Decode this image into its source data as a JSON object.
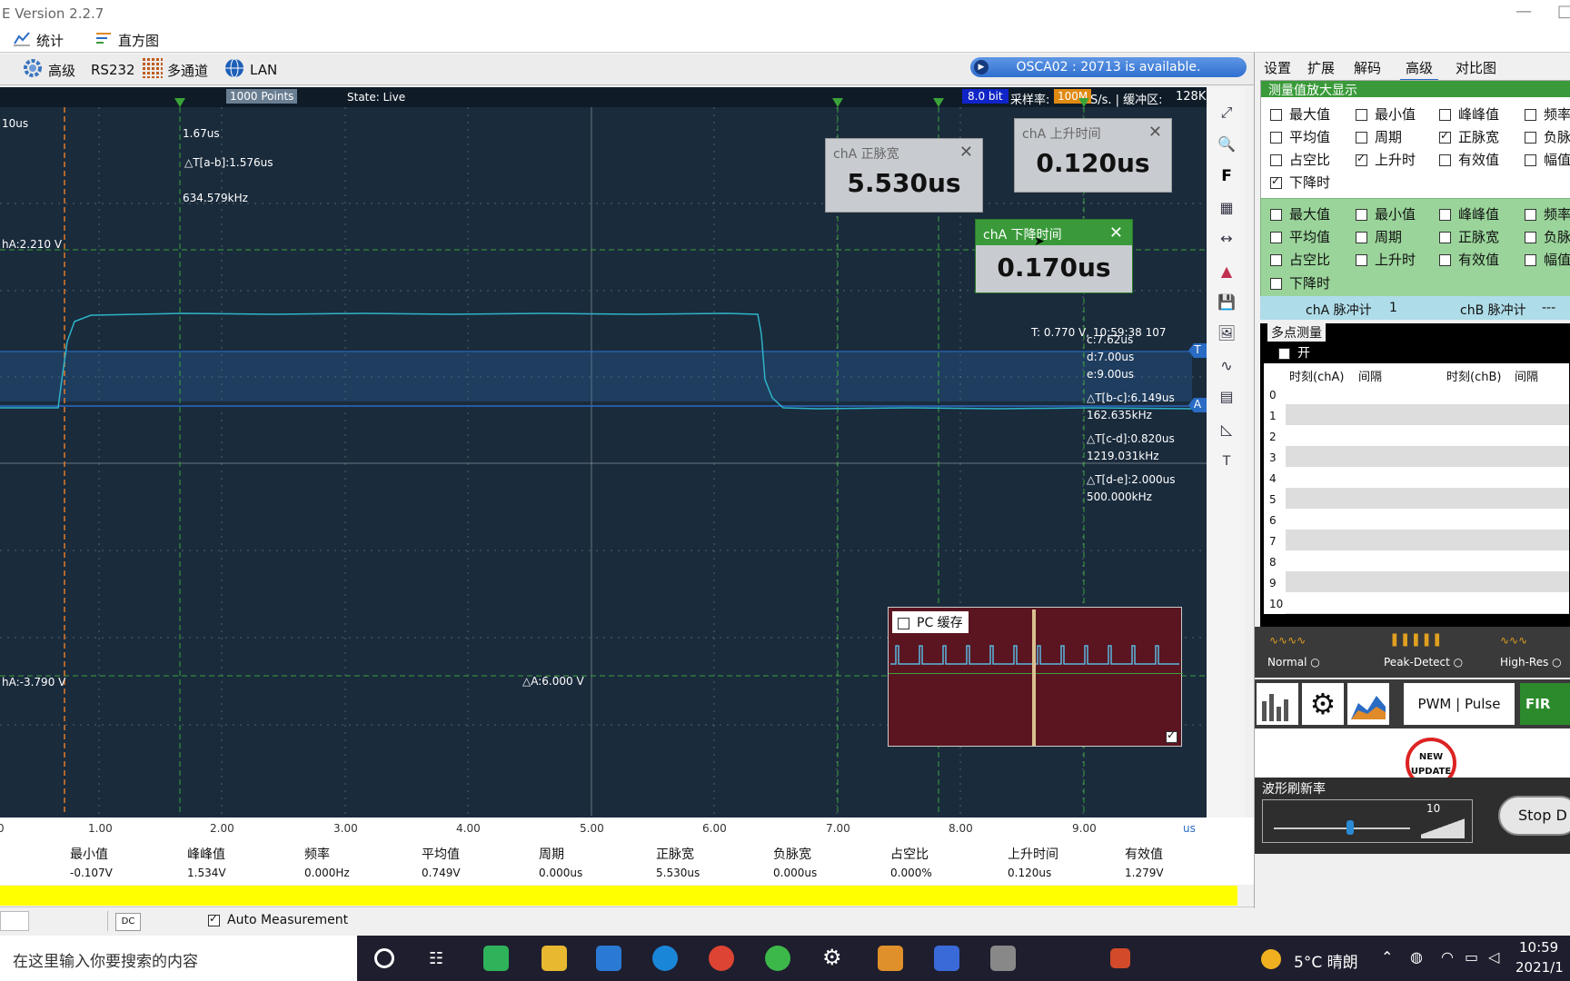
{
  "window": {
    "title": "E Version 2.2.7"
  },
  "menu": [
    {
      "label": "统计"
    },
    {
      "label": "直方图"
    }
  ],
  "toolbar": {
    "advanced": "高级",
    "rs232": "RS232",
    "multichannel": "多通道",
    "lan": "LAN",
    "device_status": "OSCA02 : 20713 is available."
  },
  "scope_status": {
    "points": "1000 Points",
    "state": "State: Live",
    "bits": "8.0 bit",
    "sample_rate_label": "采样率:",
    "sample_rate": "100M",
    "sample_rate_unit": "S/s. | 缓冲区:",
    "buffer": "128K."
  },
  "cursor_info": {
    "time_left": "10us",
    "cursor_b": "1.67us",
    "delta_ab": "△T[a-b]:1.576us",
    "freq_ab": "634.579kHz",
    "cha_top": "hA:2.210 V",
    "cha_bottom": "hA:-3.790 V",
    "delta_a": "△A:6.000 V",
    "trigger": "T: 0.770 V, 10:59:38 107",
    "c": "c:7.62us",
    "d": "d:7.00us",
    "e": "e:9.00us",
    "delta_bc": "△T[b-c]:6.149us",
    "freq_bc": "162.635kHz",
    "delta_cd": "△T[c-d]:0.820us",
    "freq_cd": "1219.031kHz",
    "delta_de": "△T[d-e]:2.000us",
    "freq_de": "500.000kHz",
    "marker_t": "T",
    "marker_a": "A"
  },
  "measurement_boxes": [
    {
      "title": "chA 正脉宽",
      "value": "5.530us"
    },
    {
      "title": "chA 上升时间",
      "value": "0.120us"
    },
    {
      "title": "chA 下降时间",
      "value": "0.170us"
    }
  ],
  "pc_cache": {
    "label": "PC 缓存",
    "checked": false,
    "thumb_checked": true
  },
  "right_toolbar": {
    "f_label": "F",
    "t_label": "T"
  },
  "x_axis": {
    "ticks": [
      "0",
      "1.00",
      "2.00",
      "3.00",
      "4.00",
      "5.00",
      "6.00",
      "7.00",
      "8.00",
      "9.00"
    ],
    "unit": "us"
  },
  "stats": [
    {
      "label": "最小值",
      "value": "-0.107V"
    },
    {
      "label": "峰峰值",
      "value": "1.534V"
    },
    {
      "label": "频率",
      "value": "0.000Hz"
    },
    {
      "label": "平均值",
      "value": "0.749V"
    },
    {
      "label": "周期",
      "value": "0.000us"
    },
    {
      "label": "正脉宽",
      "value": "5.530us"
    },
    {
      "label": "负脉宽",
      "value": "0.000us"
    },
    {
      "label": "占空比",
      "value": "0.000%"
    },
    {
      "label": "上升时间",
      "value": "0.120us"
    },
    {
      "label": "有效值",
      "value": "1.279V"
    }
  ],
  "bottom": {
    "dc": "DC",
    "auto_measurement": "Auto Measurement",
    "auto_checked": true
  },
  "tabs": [
    "设置",
    "扩展",
    "解码",
    "高级",
    "对比图"
  ],
  "panel": {
    "enlarge_title": "测量值放大显示",
    "cha_pulse": "chA 脉冲计",
    "cha_pulse_count": "1",
    "chb_pulse": "chB 脉冲计",
    "chb_pulse_count": "---",
    "multipoint": "多点测量",
    "open": "开",
    "table_headers": [
      "时刻(chA)",
      "间隔",
      "时刻(chB)",
      "间隔"
    ],
    "rows": [
      "0",
      "1",
      "2",
      "3",
      "4",
      "5",
      "6",
      "7",
      "8",
      "9",
      "10"
    ],
    "refresh_label": "波形刷新率",
    "refresh_value": "10",
    "stop": "Stop D",
    "pwm": "PWM | Pulse",
    "fir": "FIR",
    "new_update": "NEW UPDATE"
  },
  "checks_a": [
    {
      "label": "最大值",
      "on": false
    },
    {
      "label": "最小值",
      "on": false
    },
    {
      "label": "峰峰值",
      "on": false
    },
    {
      "label": "频率",
      "on": false
    },
    {
      "label": "平均值",
      "on": false
    },
    {
      "label": "周期",
      "on": false
    },
    {
      "label": "正脉宽",
      "on": true
    },
    {
      "label": "负脉",
      "on": false
    },
    {
      "label": "占空比",
      "on": false
    },
    {
      "label": "上升时",
      "on": true
    },
    {
      "label": "有效值",
      "on": false
    },
    {
      "label": "幅值",
      "on": false
    },
    {
      "label": "下降时",
      "on": true
    }
  ],
  "checks_b": [
    {
      "label": "最大值",
      "on": false
    },
    {
      "label": "最小值",
      "on": false
    },
    {
      "label": "峰峰值",
      "on": false
    },
    {
      "label": "频率",
      "on": false
    },
    {
      "label": "平均值",
      "on": false
    },
    {
      "label": "周期",
      "on": false
    },
    {
      "label": "正脉宽",
      "on": false
    },
    {
      "label": "负脉",
      "on": false
    },
    {
      "label": "占空比",
      "on": false
    },
    {
      "label": "上升时",
      "on": false
    },
    {
      "label": "有效值",
      "on": false
    },
    {
      "label": "幅值",
      "on": false
    },
    {
      "label": "下降时",
      "on": false
    }
  ],
  "modes": [
    {
      "label": "Normal",
      "selected": false
    },
    {
      "label": "Peak-Detect",
      "selected": false
    },
    {
      "label": "High-Res",
      "selected": false
    }
  ],
  "taskbar": {
    "search": "在这里输入你要搜索的内容",
    "weather": "5°C 晴朗",
    "time": "10:59",
    "date": "2021/1"
  },
  "colors": {
    "scope_bg": "#1a2b3c",
    "trace": "#2fb3c8",
    "cursor_green": "#3aa33a",
    "cursor_orange": "#e07a2a",
    "accent_green": "#3a9a3a",
    "cache_bg": "#5a1520",
    "yellow_bar": "#ffff00"
  }
}
